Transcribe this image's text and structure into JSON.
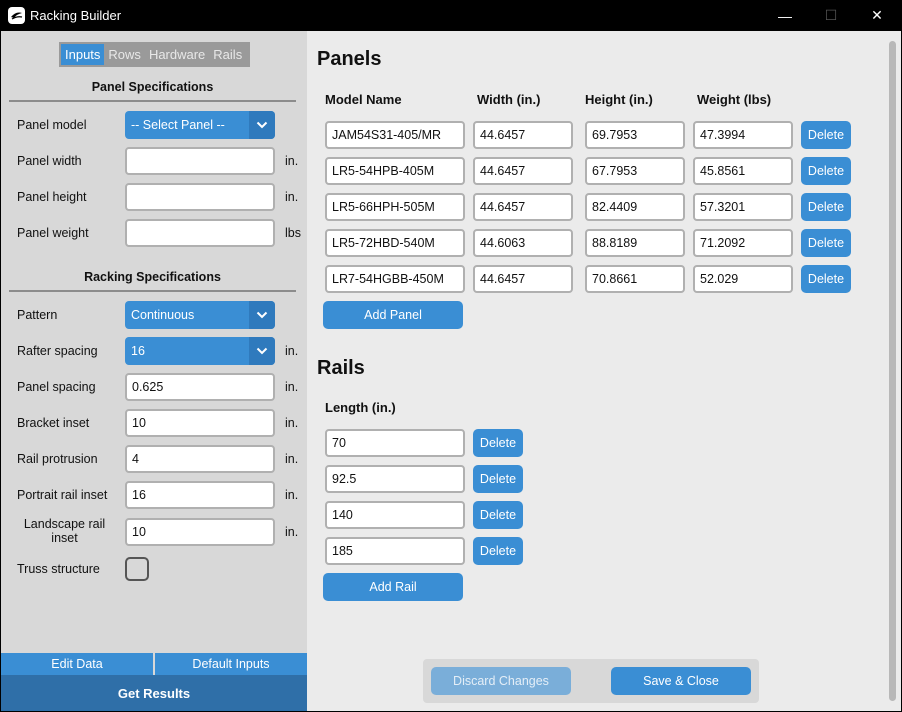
{
  "window": {
    "title": "Racking Builder",
    "minimize": "—",
    "maximize": "☐",
    "close": "✕"
  },
  "tabs": [
    {
      "label": "Inputs",
      "active": true
    },
    {
      "label": "Rows",
      "active": false
    },
    {
      "label": "Hardware",
      "active": false
    },
    {
      "label": "Rails",
      "active": false
    }
  ],
  "panel_specs": {
    "title": "Panel Specifications",
    "model_label": "Panel model",
    "model_value": "-- Select Panel --",
    "width_label": "Panel width",
    "width_value": "",
    "width_unit": "in.",
    "height_label": "Panel height",
    "height_value": "",
    "height_unit": "in.",
    "weight_label": "Panel weight",
    "weight_value": "",
    "weight_unit": "lbs"
  },
  "racking_specs": {
    "title": "Racking Specifications",
    "pattern_label": "Pattern",
    "pattern_value": "Continuous",
    "rafter_label": "Rafter spacing",
    "rafter_value": "16",
    "rafter_unit": "in.",
    "panel_spacing_label": "Panel spacing",
    "panel_spacing_value": "0.625",
    "panel_spacing_unit": "in.",
    "bracket_label": "Bracket inset",
    "bracket_value": "10",
    "bracket_unit": "in.",
    "protrusion_label": "Rail protrusion",
    "protrusion_value": "4",
    "protrusion_unit": "in.",
    "portrait_label": "Portrait rail inset",
    "portrait_value": "16",
    "portrait_unit": "in.",
    "landscape_label_1": "Landscape rail",
    "landscape_label_2": "inset",
    "landscape_value": "10",
    "landscape_unit": "in.",
    "truss_label": "Truss structure",
    "truss_checked": false
  },
  "left_footer": {
    "edit_data": "Edit Data",
    "default_inputs": "Default Inputs",
    "get_results": "Get Results"
  },
  "panels": {
    "title": "Panels",
    "headers": {
      "model": "Model Name",
      "width": "Width (in.)",
      "height": "Height (in.)",
      "weight": "Weight (lbs)"
    },
    "rows": [
      {
        "model": "JAM54S31-405/MR",
        "width": "44.6457",
        "height": "69.7953",
        "weight": "47.3994",
        "action": "Delete"
      },
      {
        "model": "LR5-54HPB-405M",
        "width": "44.6457",
        "height": "67.7953",
        "weight": "45.8561",
        "action": "Delete"
      },
      {
        "model": "LR5-66HPH-505M",
        "width": "44.6457",
        "height": "82.4409",
        "weight": "57.3201",
        "action": "Delete"
      },
      {
        "model": "LR5-72HBD-540M",
        "width": "44.6063",
        "height": "88.8189",
        "weight": "71.2092",
        "action": "Delete"
      },
      {
        "model": "LR7-54HGBB-450M",
        "width": "44.6457",
        "height": "70.8661",
        "weight": "52.029",
        "action": "Delete"
      }
    ],
    "add_label": "Add Panel"
  },
  "rails": {
    "title": "Rails",
    "header": "Length (in.)",
    "rows": [
      {
        "length": "70",
        "action": "Delete"
      },
      {
        "length": "92.5",
        "action": "Delete"
      },
      {
        "length": "140",
        "action": "Delete"
      },
      {
        "length": "185",
        "action": "Delete"
      }
    ],
    "add_label": "Add Rail"
  },
  "footer": {
    "discard": "Discard Changes",
    "save": "Save & Close"
  },
  "colors": {
    "accent": "#3a8ed4",
    "accent_dark": "#2f6fa8",
    "left_bg": "#d8d8d8",
    "right_bg": "#ebebeb"
  }
}
